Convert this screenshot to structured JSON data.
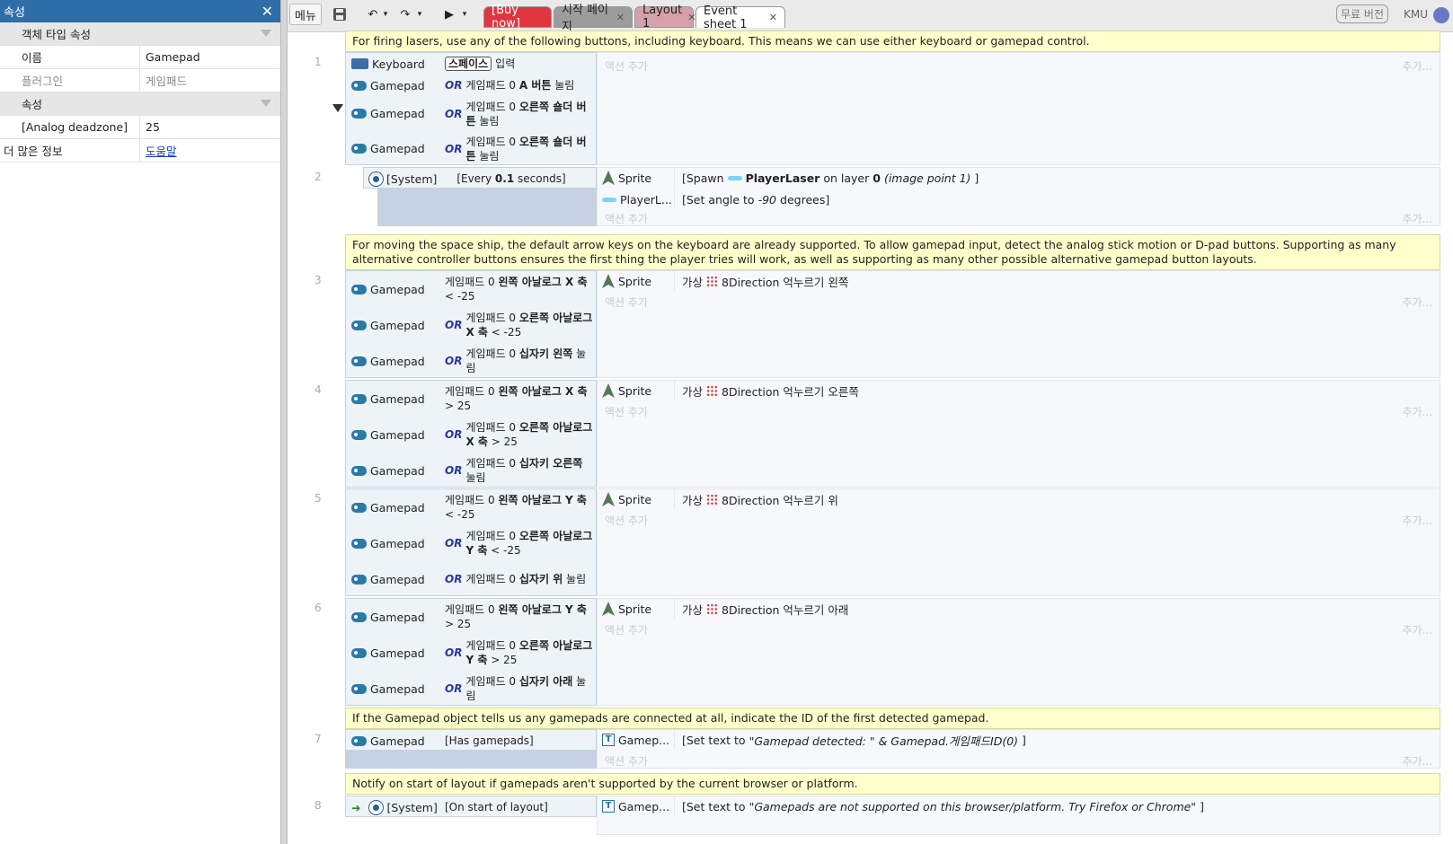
{
  "left": {
    "title": "속성",
    "rows": [
      {
        "type": "section",
        "label": "객체 타입 속성"
      },
      {
        "type": "kv",
        "key": "이름",
        "value": "Gamepad"
      },
      {
        "type": "kv",
        "key": "플러그인",
        "value": "게임패드",
        "grey": true
      },
      {
        "type": "section",
        "label": "속성"
      },
      {
        "type": "kv",
        "key": "[Analog deadzone]",
        "value": "25"
      },
      {
        "type": "kvlink",
        "key": "더 많은 정보",
        "value": "도움말"
      }
    ]
  },
  "toolbar": {
    "menu": "메뉴",
    "tabs": [
      {
        "label": "[Buy now]",
        "style": "buy",
        "close": false
      },
      {
        "label": "시작 페이지",
        "style": "grey",
        "close": true
      },
      {
        "label": "Layout 1",
        "style": "pink",
        "close": true
      },
      {
        "label": "Event sheet 1",
        "style": "active",
        "close": true
      }
    ],
    "free_version": "무료 버전",
    "user": "KMU"
  },
  "sheet": {
    "add_action": "액션 추가",
    "more": "추가...",
    "comments": [
      "For firing lasers, use any of the following buttons, including keyboard. This means we can use either keyboard or gamepad control.",
      "For moving the space ship, the default arrow keys on the keyboard are already supported. To allow gamepad input, detect the analog stick motion or D-pad buttons. Supporting as many alternative controller buttons ensures the first thing the player tries will work, as well as supporting as many other possible alternative gamepad button layouts.",
      "If the Gamepad object tells us any gamepads are connected at all, indicate the ID of the first detected gamepad.",
      "Notify on start of layout if gamepads aren't supported by the current browser or platform."
    ],
    "events": [
      {
        "num": "1",
        "conditions": [
          {
            "icon": "kb",
            "obj": "Keyboard",
            "or": false,
            "key": "스페이스",
            "text": "입력"
          },
          {
            "icon": "gp",
            "obj": "Gamepad",
            "or": true,
            "text": "게임패드 0 ",
            "bold": "A 버튼",
            "tail": " 눌림"
          },
          {
            "icon": "gp",
            "obj": "Gamepad",
            "or": true,
            "text": "게임패드 0 ",
            "bold": "오른쪽 숄더 버튼",
            "tail": " 눌림"
          },
          {
            "icon": "gp",
            "obj": "Gamepad",
            "or": true,
            "text": "게임패드 0 ",
            "bold": "오른쪽 숄더 버튼",
            "tail": " 눌림"
          }
        ],
        "actions": []
      },
      {
        "num": "2",
        "conditions": [
          {
            "icon": "gear",
            "obj": "[System]",
            "or": false,
            "text": "[Every ",
            "bold": "0.1",
            "tail": " seconds]"
          }
        ],
        "actions": [
          {
            "icon": "sprite",
            "obj": "Sprite",
            "pre": "[Spawn ",
            "laser": true,
            "bold": "PlayerLaser",
            "mid": " on layer ",
            "bold2": "0",
            "italic": " (image point 1)",
            "post": "]"
          },
          {
            "icon": "laser",
            "obj": "PlayerL...",
            "pre": "[Set angle to ",
            "italic": "-90",
            "post": " degrees]"
          }
        ]
      },
      {
        "num": "3",
        "conditions": [
          {
            "icon": "gp",
            "obj": "Gamepad",
            "or": false,
            "text": "게임패드 0 ",
            "bold": "왼쪽 아날로그 X 축",
            "tail": " < -25"
          },
          {
            "icon": "gp",
            "obj": "Gamepad",
            "or": true,
            "text": "게임패드 0 ",
            "bold": "오른쪽 아날로그 X 축",
            "tail": " < -25"
          },
          {
            "icon": "gp",
            "obj": "Gamepad",
            "or": true,
            "text": "게임패드 0 ",
            "bold": "십자키 왼쪽",
            "tail": " 눌림"
          }
        ],
        "actions": [
          {
            "icon": "sprite",
            "obj": "Sprite",
            "pre": "가상 ",
            "dots": true,
            "post": "8Direction 억누르기 왼쪽"
          }
        ]
      },
      {
        "num": "4",
        "conditions": [
          {
            "icon": "gp",
            "obj": "Gamepad",
            "or": false,
            "text": "게임패드 0 ",
            "bold": "왼쪽 아날로그 X 축",
            "tail": " > 25"
          },
          {
            "icon": "gp",
            "obj": "Gamepad",
            "or": true,
            "text": "게임패드 0 ",
            "bold": "오른쪽 아날로그 X 축",
            "tail": " > 25"
          },
          {
            "icon": "gp",
            "obj": "Gamepad",
            "or": true,
            "text": "게임패드 0 ",
            "bold": "십자키 오른쪽",
            "tail": " 눌림"
          }
        ],
        "actions": [
          {
            "icon": "sprite",
            "obj": "Sprite",
            "pre": "가상 ",
            "dots": true,
            "post": "8Direction 억누르기 오른쪽"
          }
        ]
      },
      {
        "num": "5",
        "conditions": [
          {
            "icon": "gp",
            "obj": "Gamepad",
            "or": false,
            "text": "게임패드 0 ",
            "bold": "왼쪽 아날로그 Y 축",
            "tail": " < -25"
          },
          {
            "icon": "gp",
            "obj": "Gamepad",
            "or": true,
            "text": "게임패드 0 ",
            "bold": "오른쪽 아날로그 Y 축",
            "tail": " < -25"
          },
          {
            "icon": "gp",
            "obj": "Gamepad",
            "or": true,
            "text": "게임패드 0 ",
            "bold": "십자키 위",
            "tail": " 눌림"
          }
        ],
        "actions": [
          {
            "icon": "sprite",
            "obj": "Sprite",
            "pre": "가상 ",
            "dots": true,
            "post": "8Direction 억누르기 위"
          }
        ]
      },
      {
        "num": "6",
        "conditions": [
          {
            "icon": "gp",
            "obj": "Gamepad",
            "or": false,
            "text": "게임패드 0 ",
            "bold": "왼쪽 아날로그 Y 축",
            "tail": " > 25"
          },
          {
            "icon": "gp",
            "obj": "Gamepad",
            "or": true,
            "text": "게임패드 0 ",
            "bold": "오른쪽 아날로그 Y 축",
            "tail": " > 25"
          },
          {
            "icon": "gp",
            "obj": "Gamepad",
            "or": true,
            "text": "게임패드 0 ",
            "bold": "십자키 아래",
            "tail": " 눌림"
          }
        ],
        "actions": [
          {
            "icon": "sprite",
            "obj": "Sprite",
            "pre": "가상 ",
            "dots": true,
            "post": "8Direction 억누르기 아래"
          }
        ]
      },
      {
        "num": "7",
        "conditions": [
          {
            "icon": "gp",
            "obj": "Gamepad",
            "or": false,
            "text": "[Has gamepads]"
          }
        ],
        "actions": [
          {
            "icon": "text",
            "obj": "Gamep...",
            "pre": "[Set text to ",
            "italic": "\"Gamepad detected: \" & Gamepad.게임패드ID(0)",
            "post": "]"
          }
        ]
      },
      {
        "num": "8",
        "conditions": [
          {
            "icon": "gear",
            "obj": "[System]",
            "or": false,
            "arrow": true,
            "text": "[On start of layout]"
          }
        ],
        "actions": [
          {
            "icon": "text",
            "obj": "Gamep...",
            "pre": "[Set text to ",
            "italic": "\"Gamepads are not supported on this browser/platform. Try Firefox or Chrome\"",
            "post": "]"
          }
        ]
      }
    ]
  }
}
